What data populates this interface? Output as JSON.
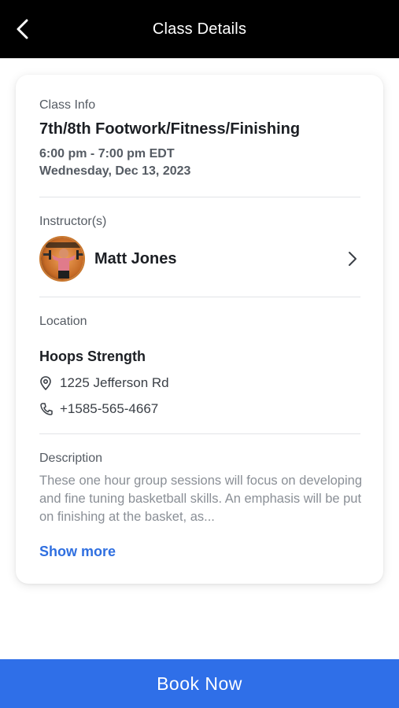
{
  "header": {
    "title": "Class Details",
    "back_icon": "chevron-left-icon"
  },
  "class_info": {
    "label": "Class Info",
    "title": "7th/8th Footwork/Fitness/Finishing",
    "time": "6:00 pm - 7:00 pm EDT",
    "date": "Wednesday, Dec 13, 2023"
  },
  "instructor": {
    "label": "Instructor(s)",
    "name": "Matt Jones",
    "avatar_icon": "avatar-photo",
    "chevron_icon": "chevron-right-icon"
  },
  "location": {
    "label": "Location",
    "name": "Hoops Strength",
    "address": "1225 Jefferson Rd",
    "phone": "+1585-565-4667",
    "address_icon": "map-pin-icon",
    "phone_icon": "phone-icon"
  },
  "description": {
    "label": "Description",
    "text": "These one hour group sessions will focus on developing and fine tuning basketball skills. An emphasis will be put on finishing at the basket, as...",
    "show_more": "Show more"
  },
  "actions": {
    "book_label": "Book Now"
  },
  "colors": {
    "header_bg": "#000000",
    "accent": "#2f6fe8",
    "link": "#2f6fe0"
  }
}
